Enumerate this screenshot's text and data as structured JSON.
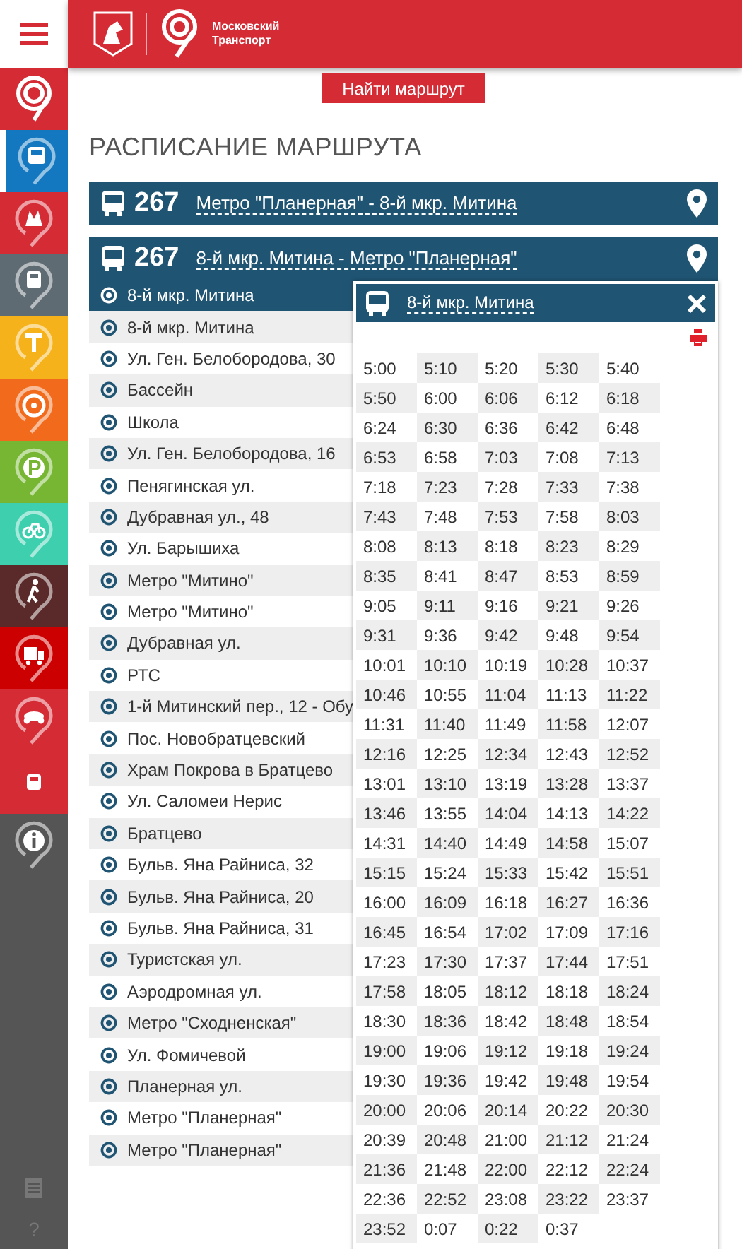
{
  "header": {
    "logo_lines": [
      "Московский",
      "Транспорт"
    ]
  },
  "sidebar": {
    "items": [
      {
        "kind": "logo",
        "color": "#d52b35",
        "selected": false
      },
      {
        "kind": "bus",
        "color": "#1378c0",
        "selected": true
      },
      {
        "kind": "metro",
        "color": "#d52b35",
        "selected": false
      },
      {
        "kind": "train",
        "color": "#5f6b73",
        "selected": false
      },
      {
        "kind": "taxi",
        "color": "#f5b21b",
        "selected": false
      },
      {
        "kind": "car",
        "color": "#f26b1d",
        "selected": false
      },
      {
        "kind": "parking",
        "color": "#77b633",
        "selected": false
      },
      {
        "kind": "bike",
        "color": "#3dcfae",
        "selected": false
      },
      {
        "kind": "walk",
        "color": "#5a2a2a",
        "selected": false
      },
      {
        "kind": "truck",
        "color": "#cc0000",
        "selected": false
      },
      {
        "kind": "moto",
        "color": "#d52b35",
        "selected": false
      },
      {
        "kind": "tram",
        "color": "#d52b35",
        "selected": false
      },
      {
        "kind": "info",
        "color": "#555555",
        "selected": false
      }
    ],
    "help": "?"
  },
  "find_button": "Найти маршрут",
  "title": "РАСПИСАНИЕ МАРШРУТА",
  "routes": [
    {
      "number": "267",
      "name": "Метро \"Планерная\" - 8-й мкр. Митина"
    },
    {
      "number": "267",
      "name": "8-й мкр. Митина - Метро \"Планерная\""
    }
  ],
  "stops": [
    {
      "name": "8-й мкр. Митина",
      "selected": true
    },
    {
      "name": "8-й мкр. Митина",
      "selected": false
    },
    {
      "name": "Ул. Ген. Белобородова, 30",
      "selected": false
    },
    {
      "name": "Бассейн",
      "selected": false
    },
    {
      "name": "Школа",
      "selected": false
    },
    {
      "name": "Ул. Ген. Белобородова, 16",
      "selected": false
    },
    {
      "name": "Пенягинская ул.",
      "selected": false
    },
    {
      "name": "Дубравная ул., 48",
      "selected": false
    },
    {
      "name": "Ул. Барышиха",
      "selected": false
    },
    {
      "name": "Метро \"Митино\"",
      "selected": false
    },
    {
      "name": "Метро \"Митино\"",
      "selected": false
    },
    {
      "name": "Дубравная ул.",
      "selected": false
    },
    {
      "name": "РТС",
      "selected": false
    },
    {
      "name": "1-й Митинский пер., 12 - Обу",
      "selected": false
    },
    {
      "name": "Пос. Новобратцевский",
      "selected": false
    },
    {
      "name": "Храм Покрова в Братцево",
      "selected": false
    },
    {
      "name": "Ул. Саломеи Нерис",
      "selected": false
    },
    {
      "name": "Братцево",
      "selected": false
    },
    {
      "name": "Бульв. Яна Райниса, 32",
      "selected": false
    },
    {
      "name": "Бульв. Яна Райниса, 20",
      "selected": false
    },
    {
      "name": "Бульв. Яна Райниса, 31",
      "selected": false
    },
    {
      "name": "Туристская ул.",
      "selected": false
    },
    {
      "name": "Аэродромная ул.",
      "selected": false
    },
    {
      "name": "Метро \"Сходненская\"",
      "selected": false
    },
    {
      "name": "Ул. Фомичевой",
      "selected": false
    },
    {
      "name": "Планерная ул.",
      "selected": false
    },
    {
      "name": "Метро \"Планерная\"",
      "selected": false
    },
    {
      "name": "Метро \"Планерная\"",
      "selected": false
    }
  ],
  "popup": {
    "stop": "8-й мкр. Митина",
    "times": [
      "5:00",
      "5:10",
      "5:20",
      "5:30",
      "5:40",
      "5:50",
      "6:00",
      "6:06",
      "6:12",
      "6:18",
      "6:24",
      "6:30",
      "6:36",
      "6:42",
      "6:48",
      "6:53",
      "6:58",
      "7:03",
      "7:08",
      "7:13",
      "7:18",
      "7:23",
      "7:28",
      "7:33",
      "7:38",
      "7:43",
      "7:48",
      "7:53",
      "7:58",
      "8:03",
      "8:08",
      "8:13",
      "8:18",
      "8:23",
      "8:29",
      "8:35",
      "8:41",
      "8:47",
      "8:53",
      "8:59",
      "9:05",
      "9:11",
      "9:16",
      "9:21",
      "9:26",
      "9:31",
      "9:36",
      "9:42",
      "9:48",
      "9:54",
      "10:01",
      "10:10",
      "10:19",
      "10:28",
      "10:37",
      "10:46",
      "10:55",
      "11:04",
      "11:13",
      "11:22",
      "11:31",
      "11:40",
      "11:49",
      "11:58",
      "12:07",
      "12:16",
      "12:25",
      "12:34",
      "12:43",
      "12:52",
      "13:01",
      "13:10",
      "13:19",
      "13:28",
      "13:37",
      "13:46",
      "13:55",
      "14:04",
      "14:13",
      "14:22",
      "14:31",
      "14:40",
      "14:49",
      "14:58",
      "15:07",
      "15:15",
      "15:24",
      "15:33",
      "15:42",
      "15:51",
      "16:00",
      "16:09",
      "16:18",
      "16:27",
      "16:36",
      "16:45",
      "16:54",
      "17:02",
      "17:09",
      "17:16",
      "17:23",
      "17:30",
      "17:37",
      "17:44",
      "17:51",
      "17:58",
      "18:05",
      "18:12",
      "18:18",
      "18:24",
      "18:30",
      "18:36",
      "18:42",
      "18:48",
      "18:54",
      "19:00",
      "19:06",
      "19:12",
      "19:18",
      "19:24",
      "19:30",
      "19:36",
      "19:42",
      "19:48",
      "19:54",
      "20:00",
      "20:06",
      "20:14",
      "20:22",
      "20:30",
      "20:39",
      "20:48",
      "21:00",
      "21:12",
      "21:24",
      "21:36",
      "21:48",
      "22:00",
      "22:12",
      "22:24",
      "22:36",
      "22:52",
      "23:08",
      "23:22",
      "23:37",
      "23:52",
      "0:07",
      "0:22",
      "0:37"
    ]
  }
}
